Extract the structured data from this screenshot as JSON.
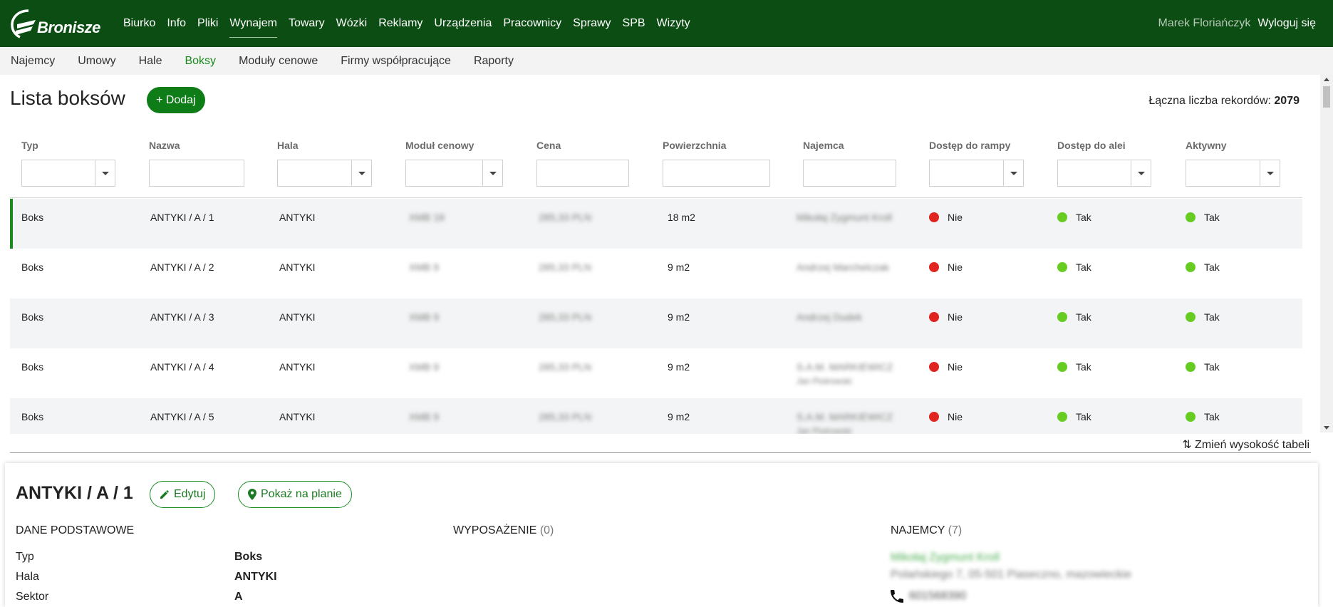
{
  "brand": {
    "logo_text": "Bronisze"
  },
  "topnav": {
    "items": [
      "Biurko",
      "Info",
      "Pliki",
      "Wynajem",
      "Towary",
      "Wózki",
      "Reklamy",
      "Urządzenia",
      "Pracownicy",
      "Sprawy",
      "SPB",
      "Wizyty"
    ],
    "active": "Wynajem"
  },
  "user": {
    "name": "Marek Floriańczyk",
    "logout_label": "Wyloguj się"
  },
  "subnav": {
    "items": [
      "Najemcy",
      "Umowy",
      "Hale",
      "Boksy",
      "Moduły cenowe",
      "Firmy współpracujące",
      "Raporty"
    ],
    "active": "Boksy"
  },
  "list": {
    "title": "Lista boksów",
    "add_label": "+ Dodaj",
    "total_label": "Łączna liczba rekordów:",
    "total_value": "2079"
  },
  "columns": [
    "Typ",
    "Nazwa",
    "Hala",
    "Moduł cenowy",
    "Cena",
    "Powierzchnia",
    "Najemca",
    "Dostęp do rampy",
    "Dostęp do alei",
    "Aktywny"
  ],
  "rows": [
    {
      "typ": "Boks",
      "nazwa": "ANTYKI / A / 1",
      "hala": "ANTYKI",
      "modul": "XMB 18",
      "cena": "285,33 PLN",
      "pow": "18 m2",
      "najemca": "Mikołaj Zygmunt Kroll",
      "najemca2": "",
      "rampa": "Nie",
      "aleja": "Tak",
      "aktywny": "Tak"
    },
    {
      "typ": "Boks",
      "nazwa": "ANTYKI / A / 2",
      "hala": "ANTYKI",
      "modul": "XMB 9",
      "cena": "285,33 PLN",
      "pow": "9 m2",
      "najemca": "Andrzej Marchelczak",
      "najemca2": "",
      "rampa": "Nie",
      "aleja": "Tak",
      "aktywny": "Tak"
    },
    {
      "typ": "Boks",
      "nazwa": "ANTYKI / A / 3",
      "hala": "ANTYKI",
      "modul": "XMB 9",
      "cena": "285,33 PLN",
      "pow": "9 m2",
      "najemca": "Andrzej Dudek",
      "najemca2": "",
      "rampa": "Nie",
      "aleja": "Tak",
      "aktywny": "Tak"
    },
    {
      "typ": "Boks",
      "nazwa": "ANTYKI / A / 4",
      "hala": "ANTYKI",
      "modul": "XMB 9",
      "cena": "285,33 PLN",
      "pow": "9 m2",
      "najemca": "S.A.M. MARKIEWICZ",
      "najemca2": "Jan Piotrowski",
      "rampa": "Nie",
      "aleja": "Tak",
      "aktywny": "Tak"
    },
    {
      "typ": "Boks",
      "nazwa": "ANTYKI / A / 5",
      "hala": "ANTYKI",
      "modul": "XMB 9",
      "cena": "285,33 PLN",
      "pow": "9 m2",
      "najemca": "S.A.M. MARKIEWICZ",
      "najemca2": "Jan Piotrowski",
      "rampa": "Nie",
      "aleja": "Tak",
      "aktywny": "Tak"
    }
  ],
  "resize_label": "⇅ Zmień wysokość tabeli",
  "detail": {
    "title": "ANTYKI / A / 1",
    "edit_label": "Edytuj",
    "plan_label": "Pokaż na planie",
    "sections": {
      "basic": "DANE PODSTAWOWE",
      "equipment": "WYPOSAŻENIE",
      "equipment_count": "(0)",
      "tenants": "NAJEMCY",
      "tenants_count": "(7)"
    },
    "fields": [
      {
        "label": "Typ",
        "value": "Boks"
      },
      {
        "label": "Hala",
        "value": "ANTYKI"
      },
      {
        "label": "Sektor",
        "value": "A"
      }
    ],
    "tenant": {
      "name": "Mikołaj Zygmunt Kroll",
      "address": "Polańskiego 7, 05-501 Piaseczno, mazowieckie",
      "phone": "601568390"
    }
  },
  "colors": {
    "navbar": "#0b4d12",
    "accent": "#1b8a22",
    "status_no": "#e0241f",
    "status_yes": "#66cc22"
  }
}
